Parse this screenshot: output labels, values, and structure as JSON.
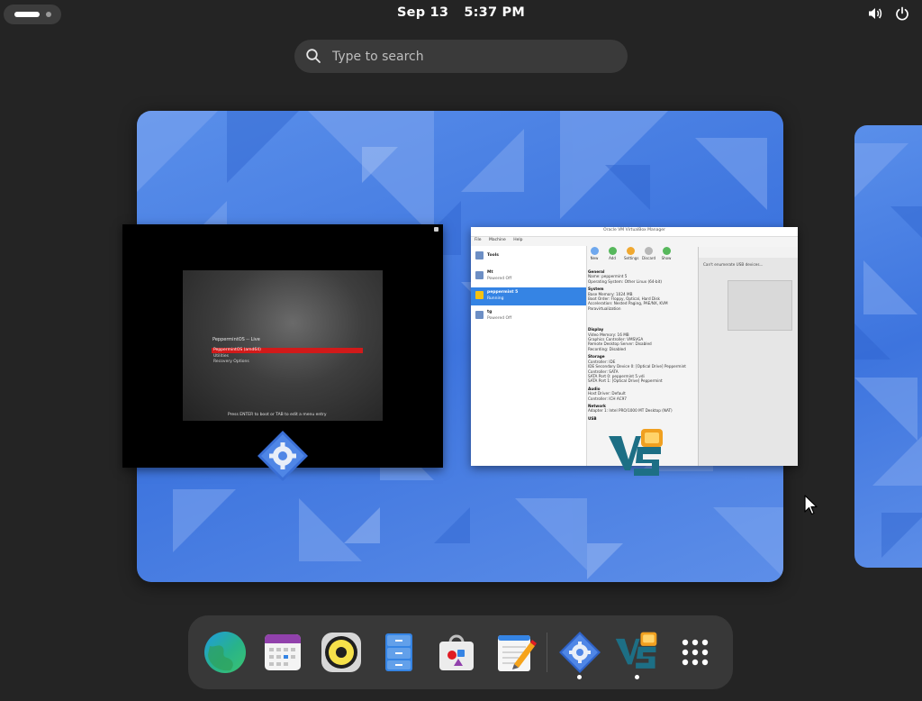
{
  "topbar": {
    "date": "Sep 13",
    "time": "5:37 PM",
    "icons": [
      "activities-indicator",
      "volume-icon",
      "power-icon"
    ]
  },
  "search": {
    "placeholder": "Type to search",
    "value": ""
  },
  "workspace": {
    "windows": [
      {
        "app": "puppemint-vm",
        "boot": {
          "title": "PeppermintOS -- Live",
          "selected": "PeppermintOS (amd64)",
          "options": [
            "Utilities",
            "Recovery Options"
          ],
          "hint": "Press ENTER to boot or TAB to edit a menu entry"
        }
      },
      {
        "app": "virtualbox-manager",
        "title": "Oracle VM VirtualBox Manager",
        "menu": [
          "File",
          "Machine",
          "Help"
        ],
        "vm_list": [
          {
            "name": "Tools",
            "status": ""
          },
          {
            "name": "Mt",
            "status": "Powered Off"
          },
          {
            "name": "peppermint 5",
            "status": "Running"
          },
          {
            "name": "tg",
            "status": "Powered Off"
          }
        ],
        "toolbar": [
          "New",
          "Add",
          "Settings",
          "Discard",
          "Show"
        ],
        "details": {
          "general_header": "General",
          "general_lines": [
            "Name: peppermint 5",
            "Operating System: Other Linux (64-bit)"
          ],
          "system_header": "System",
          "system_lines": [
            "Base Memory: 1024 MB",
            "Boot Order: Floppy, Optical, Hard Disk",
            "Acceleration: Nested Paging, PAE/NX, KVM Paravirtualization"
          ],
          "display_header": "Display",
          "display_lines": [
            "Video Memory: 16 MB",
            "Graphics Controller: VMSVGA",
            "Remote Desktop Server: Disabled",
            "Recording: Disabled"
          ],
          "storage_header": "Storage",
          "storage_lines": [
            "Controller: IDE",
            "IDE Secondary Device 0: [Optical Drive] Peppermint",
            "Controller: SATA",
            "SATA Port 0: peppermint 5.vdi",
            "SATA Port 1: [Optical Drive] Peppermint"
          ],
          "audio_header": "Audio",
          "audio_lines": [
            "Host Driver: Default",
            "Controller: ICH AC97"
          ],
          "network_header": "Network",
          "network_lines": [
            "Adapter 1: Intel PRO/1000 MT Desktop (NAT)"
          ],
          "usb_header": "USB"
        },
        "dialog_title": "Can't enumerate USB devices..."
      }
    ]
  },
  "dash": {
    "apps": [
      {
        "name": "browser",
        "icon": "globe-icon",
        "running": false
      },
      {
        "name": "calendar",
        "icon": "calendar-icon",
        "running": false
      },
      {
        "name": "rhythmbox",
        "icon": "speaker-icon",
        "running": false
      },
      {
        "name": "files",
        "icon": "file-cabinet-icon",
        "running": false
      },
      {
        "name": "software",
        "icon": "shopping-bag-icon",
        "running": false
      },
      {
        "name": "text-editor",
        "icon": "notepad-pencil-icon",
        "running": false
      },
      {
        "name": "settings",
        "icon": "gear-diamond-icon",
        "running": true
      },
      {
        "name": "virtualbox",
        "icon": "virtualbox-icon",
        "running": true
      },
      {
        "name": "show-apps",
        "icon": "grid-icon",
        "running": false
      }
    ]
  },
  "colors": {
    "panel_bg": "#242424",
    "dash_bg": "#383838",
    "search_bg": "#3a3a3a",
    "wallpaper_blue": "#3d74de",
    "accent_blue": "#3584e4",
    "boot_select_red": "#d11a1a"
  }
}
